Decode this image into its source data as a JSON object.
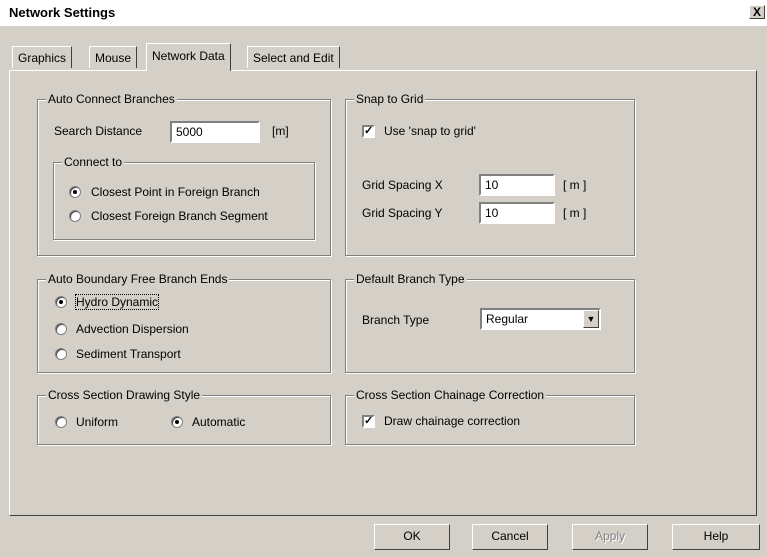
{
  "window": {
    "title": "Network Settings",
    "close_glyph": "X"
  },
  "tabs": [
    {
      "label": "Graphics"
    },
    {
      "label": "Mouse"
    },
    {
      "label": "Network Data",
      "active": true
    },
    {
      "label": "Select and Edit"
    }
  ],
  "auto_connect": {
    "legend": "Auto Connect Branches",
    "search_label": "Search Distance",
    "search_value": "5000",
    "search_unit": "[m]",
    "connect_to": {
      "legend": "Connect to",
      "options": [
        {
          "label": "Closest Point in Foreign Branch",
          "selected": true
        },
        {
          "label": "Closest Foreign Branch Segment",
          "selected": false
        }
      ]
    }
  },
  "snap_to_grid": {
    "legend": "Snap to Grid",
    "use_label": "Use 'snap to grid'",
    "use_checked": true,
    "spacing_x_label": "Grid Spacing X",
    "spacing_x_value": "10",
    "spacing_x_unit": "[ m ]",
    "spacing_y_label": "Grid Spacing Y",
    "spacing_y_value": "10",
    "spacing_y_unit": "[ m ]"
  },
  "boundary": {
    "legend": "Auto Boundary Free Branch Ends",
    "options": [
      {
        "label": "Hydro Dynamic",
        "selected": true
      },
      {
        "label": "Advection Dispersion",
        "selected": false
      },
      {
        "label": "Sediment Transport",
        "selected": false
      }
    ]
  },
  "branch_type": {
    "legend": "Default Branch Type",
    "label": "Branch Type",
    "value": "Regular"
  },
  "drawing_style": {
    "legend": "Cross Section Drawing Style",
    "options": [
      {
        "label": "Uniform",
        "selected": false
      },
      {
        "label": "Automatic",
        "selected": true
      }
    ]
  },
  "chainage": {
    "legend": "Cross Section Chainage Correction",
    "label": "Draw chainage correction",
    "checked": true
  },
  "buttons": {
    "ok": "OK",
    "cancel": "Cancel",
    "apply": "Apply",
    "help": "Help"
  },
  "colors": {
    "face": "#d4d0c8",
    "shadow": "#808080",
    "highlight": "#ffffff"
  }
}
